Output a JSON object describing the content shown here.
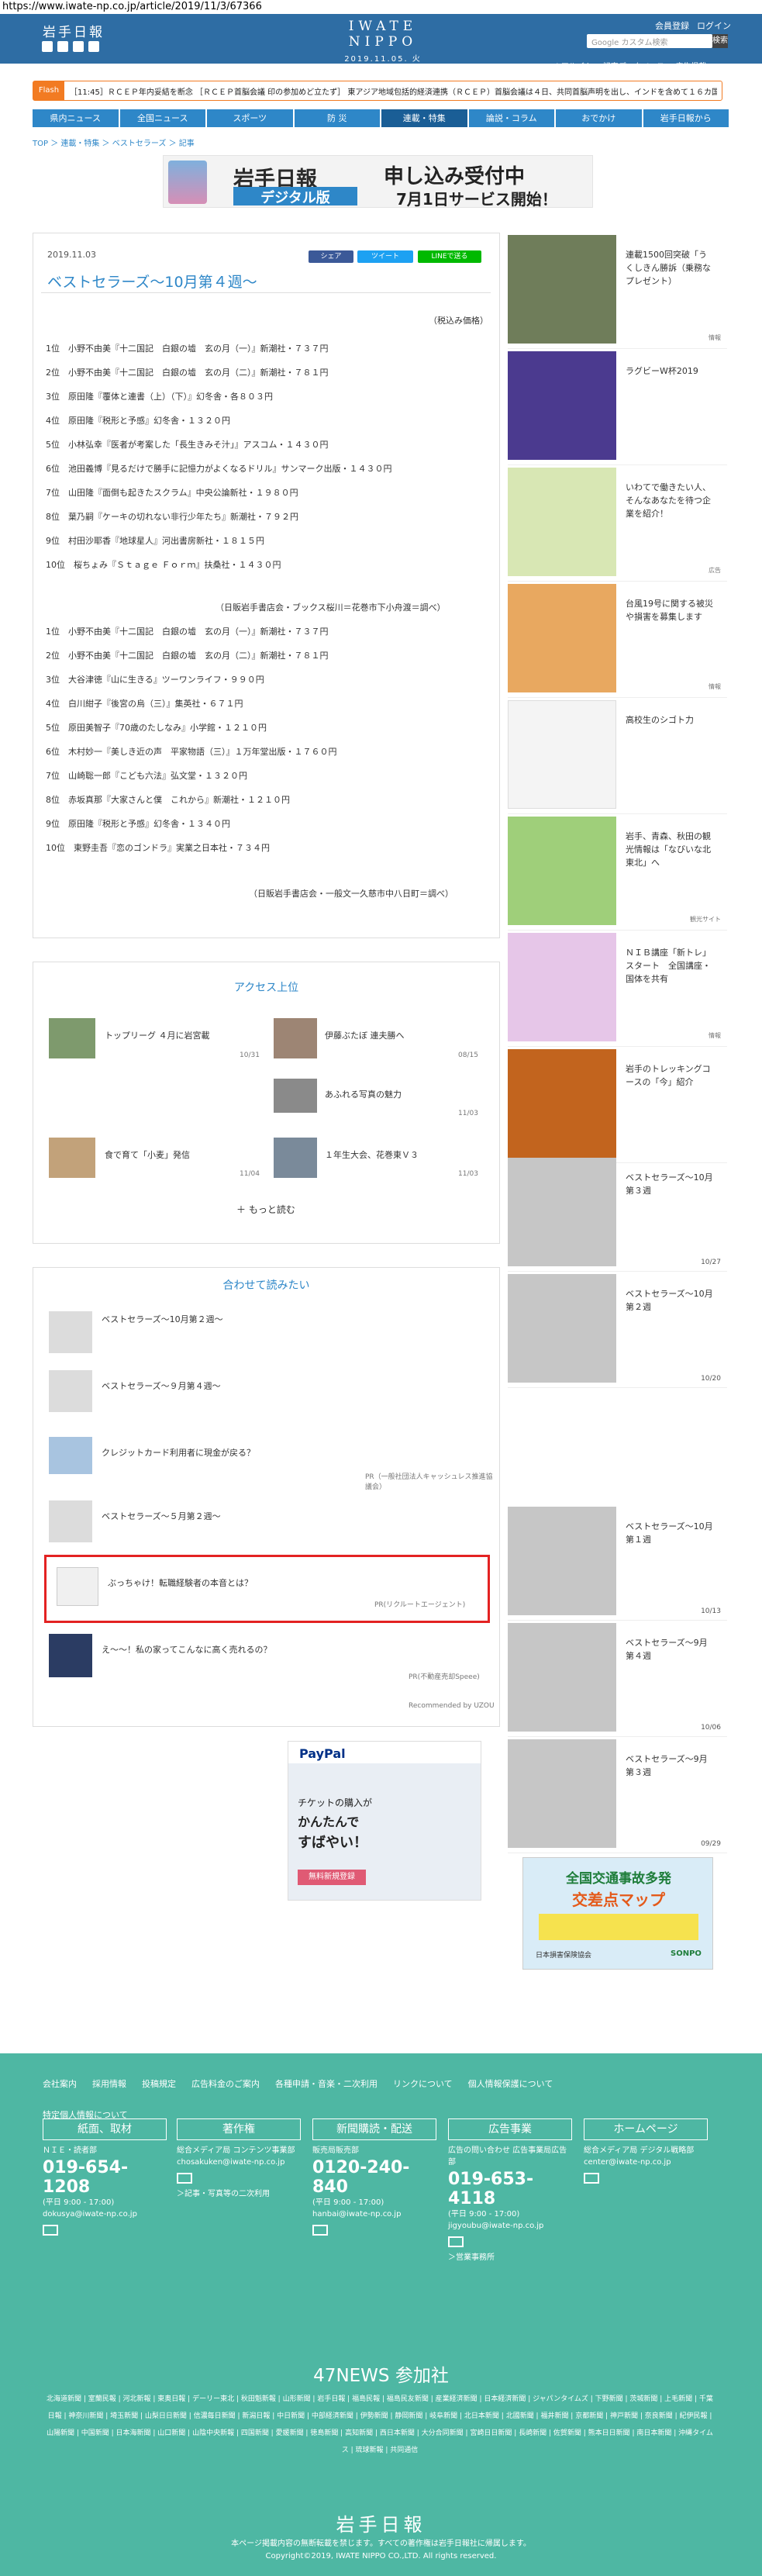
{
  "url": "https://www.iwate-np.co.jp/article/2019/11/3/67366",
  "header": {
    "logo_small": "岩手日報",
    "center_logo": "IWATE NIPPO",
    "date": "2019.11.05. 火",
    "top_links": [
      "会員登録",
      "ログイン"
    ],
    "search_placeholder": "Google カスタム検索",
    "search_button": "検索",
    "sub_links": [
      "Webアルバム",
      "記事データベース",
      "広告掲載"
    ]
  },
  "flash": {
    "tag": "Flash",
    "text": "［11:45］ＲＣＥＰ年内妥結を断念 ［ＲＣＥＰ首脳会議 印の参加めど立たず］ 東アジア地域包括的経済連携（ＲＣＥＰ）首脳会議は４日、共同首脳声明を出し、インドを含めて１６カ国でまとめ"
  },
  "nav": [
    "県内ニュース",
    "全国ニュース",
    "スポーツ",
    "防 災",
    "連載・特集",
    "論説・コラム",
    "おでかけ",
    "岩手日報から"
  ],
  "breadcrumb": "TOP ＞ 連載・特集 ＞ ベストセラーズ ＞ 記事",
  "banner": {
    "logo": "岩手日報",
    "digital": "デジタル版",
    "msg1": "申し込み受付中",
    "msg2": "7月1日サービス開始！"
  },
  "article": {
    "date": "2019.11.03",
    "share": [
      "シェア",
      "ツイート",
      "LINEで送る"
    ],
    "title": "ベストセラーズ～10月第４週～",
    "tax_note": "（税込み価格）",
    "list1": [
      "1位　小野不由美『十二国記　白銀の墟　玄の月（一）』新潮社・７３７円",
      "2位　小野不由美『十二国記　白銀の墟　玄の月（二）』新潮社・７８１円",
      "3位　原田隆『覆体と連書（上）（下）』幻冬舎・各８０３円",
      "4位　原田隆『税形と予感』幻冬舎・１３２０円",
      "5位　小林弘幸『医者が考案した「長生きみそ汁」』アスコム・１４３０円",
      "6位　池田義博『見るだけで勝手に記憶力がよくなるドリル』サンマーク出版・１４３０円",
      "7位　山田隆『面倒も起きたスクラム』中央公論新社・１９８０円",
      "8位　葉乃嗣『ケーキの切れない非行少年たち』新潮社・７９２円",
      "9位　村田沙耶香『地球星人』河出書房新社・１８１５円",
      "10位　桜ちょみ『Ｓｔａｇｅ Ｆｏｒｍ』扶桑社・１４３０円"
    ],
    "source1": "（日販岩手書店会・ブックス桜川＝花巻市下小舟渡＝調べ）",
    "list2": [
      "1位　小野不由美『十二国記　白銀の墟　玄の月（一）』新潮社・７３７円",
      "2位　小野不由美『十二国記　白銀の墟　玄の月（二）』新潮社・７８１円",
      "3位　大谷津徳『山に生きる』ツーワンライフ・９９０円",
      "4位　白川紺子『後宮の烏（三）』集英社・６７１円",
      "5位　原田美智子『70歳のたしなみ』小学館・１２１０円",
      "6位　木村妙一『美しき近の声　平家物語（三）』１万年堂出版・１７６０円",
      "7位　山崎聡一郎『こども六法』弘文堂・１３２０円",
      "8位　赤坂真那『大家さんと僕　これから』新潮社・１２１０円",
      "9位　原田隆『税形と予感』幻冬舎・１３４０円",
      "10位　東野圭吾『恋のゴンドラ』実業之日本社・７３４円"
    ],
    "source2": "（日販岩手書店会・一般文一久慈市中八日町＝調べ）"
  },
  "access": {
    "title": "アクセス上位",
    "items": [
      {
        "title": "トップリーグ ４月に岩宮載",
        "date": "10/31"
      },
      {
        "title": "伊藤ぶたぼ 連夫勝へ",
        "date": "08/15"
      },
      {
        "title": "",
        "date": ""
      },
      {
        "title": "あふれる写真の魅力",
        "date": "11/03"
      },
      {
        "title": "食で育て「小麦」発信",
        "date": "11/04"
      },
      {
        "title": "１年生大会、花巻東Ｖ３",
        "date": "11/03"
      }
    ],
    "more": "もっと読む"
  },
  "related": {
    "title": "合わせて読みたい",
    "items": [
      {
        "title": "ベストセラーズ～10月第２週～",
        "pr": ""
      },
      {
        "title": "ベストセラーズ～９月第４週～",
        "pr": ""
      },
      {
        "title": "クレジットカード利用者に現金が戻る？",
        "pr": "PR（一般社団法人キャッシュレス推進協議会）"
      },
      {
        "title": "ベストセラーズ～５月第２週～",
        "pr": ""
      },
      {
        "title": "ぶっちゃけ！転職経験者の本音とは？",
        "pr": "PR(リクルートエージェント)"
      },
      {
        "title": "え～～！私の家ってこんなに高く売れるの？",
        "pr": "PR(不動産売却Speee)"
      }
    ],
    "recommended": "Recommended by UZOU"
  },
  "ad": {
    "paypal": "PayPal",
    "copy1": "チケットの購入が",
    "copy2": "かんたんで",
    "copy3": "すばやい！",
    "cta": "無料新規登録"
  },
  "sidebar": [
    {
      "title": "連載1500回突破「うくしきん勝訴（乗務なプレゼント）",
      "src": "情報",
      "date": ""
    },
    {
      "title": "ラグビーW杯2019",
      "src": "",
      "date": ""
    },
    {
      "title": "いわてで働きたい人、そんなあなたを待つ企業を紹介！",
      "src": "広告",
      "date": ""
    },
    {
      "title": "台風19号に関する被災や損害を募集します",
      "src": "情報",
      "date": ""
    },
    {
      "title": "高校生のシゴト力",
      "src": "",
      "date": ""
    },
    {
      "title": "岩手、青森、秋田の観光情報は「なびいな北東北」へ",
      "src": "観光サイト",
      "date": ""
    },
    {
      "title": "ＮＩＢ講座「新トレ」スタート　全国講座・国体を共有",
      "src": "情報",
      "date": ""
    },
    {
      "title": "岩手のトレッキングコースの「今」紹介",
      "src": "",
      "date": ""
    },
    {
      "title": "ベストセラーズ～10月第３週",
      "src": "",
      "date": "10/27"
    },
    {
      "title": "ベストセラーズ～10月第２週",
      "src": "",
      "date": "10/20"
    },
    {
      "title": "ベストセラーズ～10月第１週",
      "src": "",
      "date": "10/13"
    },
    {
      "title": "ベストセラーズ～9月第４週",
      "src": "",
      "date": "10/06"
    },
    {
      "title": "ベストセラーズ～9月第３週",
      "src": "",
      "date": "09/29"
    }
  ],
  "side_ad": {
    "line1": "全国交通事故多発",
    "line2": "交差点マップ",
    "org": "日本損害保険協会",
    "brand": "SONPO"
  },
  "footer": {
    "links": [
      "会社案内",
      "採用情報",
      "投稿規定",
      "広告料金のご案内",
      "各種申請・音楽・二次利用",
      "リンクについて",
      "個人情報保護について",
      "特定個人情報について"
    ],
    "cols": [
      {
        "head": "紙面、取材",
        "sub": "ＮＩＥ・読者部",
        "phone": "019-654-1208",
        "hours": "(平日 9:00 - 17:00)",
        "mail": "dokusya@iwate-np.co.jp",
        "note": ""
      },
      {
        "head": "著作権",
        "sub": "総合メディア局 コンテンツ事業部",
        "phone": "",
        "hours": "",
        "mail": "chosakuken@iwate-np.co.jp",
        "note": "＞記事・写真等の二次利用"
      },
      {
        "head": "新聞購読・配送",
        "sub": "販売局販売部",
        "phone": "0120-240-840",
        "hours": "(平日 9:00 - 17:00)",
        "mail": "hanbai@iwate-np.co.jp",
        "note": ""
      },
      {
        "head": "広告事業",
        "sub": "広告の問い合わせ 広告事業局広告部",
        "phone": "019-653-4118",
        "hours": "(平日 9:00 - 17:00)",
        "mail": "jigyoubu@iwate-np.co.jp",
        "note": "＞営業事務所"
      },
      {
        "head": "ホームページ",
        "sub": "総合メディア局 デジタル戦略部",
        "phone": "",
        "hours": "",
        "mail": "center@iwate-np.co.jp",
        "note": ""
      }
    ],
    "news47_title": "47NEWS 参加社",
    "news47": "北海道新聞 | 室蘭民報 | 河北新報 | 東奥日報 | デーリー東北 | 秋田魁新報 | 山形新聞 | 岩手日報 | 福島民報 | 福島民友新聞 | 産業経済新聞 | 日本経済新聞 | ジャパンタイムズ | 下野新聞 | 茨城新聞 | 上毛新聞 | 千葉日報 | 神奈川新聞 | 埼玉新聞 | 山梨日日新聞 | 信濃毎日新聞 | 新潟日報 | 中日新聞 | 中部経済新聞 | 伊勢新聞 | 静岡新聞 | 岐阜新聞 | 北日本新聞 | 北國新聞 | 福井新聞 | 京都新聞 | 神戸新聞 | 奈良新聞 | 紀伊民報 | 山陽新聞 | 中国新聞 | 日本海新聞 | 山口新聞 | 山陰中央新報 | 四国新聞 | 愛媛新聞 | 徳島新聞 | 高知新聞 | 西日本新聞 | 大分合同新聞 | 宮崎日日新聞 | 長崎新聞 | 佐賀新聞 | 熊本日日新聞 | 南日本新聞 | 沖縄タイムス | 琉球新報 | 共同通信",
    "logo": "岩手日報",
    "copy1": "本ページ掲載内容の無断転載を禁じます。すべての著作権は岩手日報社に帰属します。",
    "copy2": "Copyright©2019, IWATE NIPPO CO.,LTD. All rights reserved."
  },
  "colors": {
    "primary": "#2e87c8",
    "footer": "#4eb7a3",
    "flash": "#f27b22"
  }
}
